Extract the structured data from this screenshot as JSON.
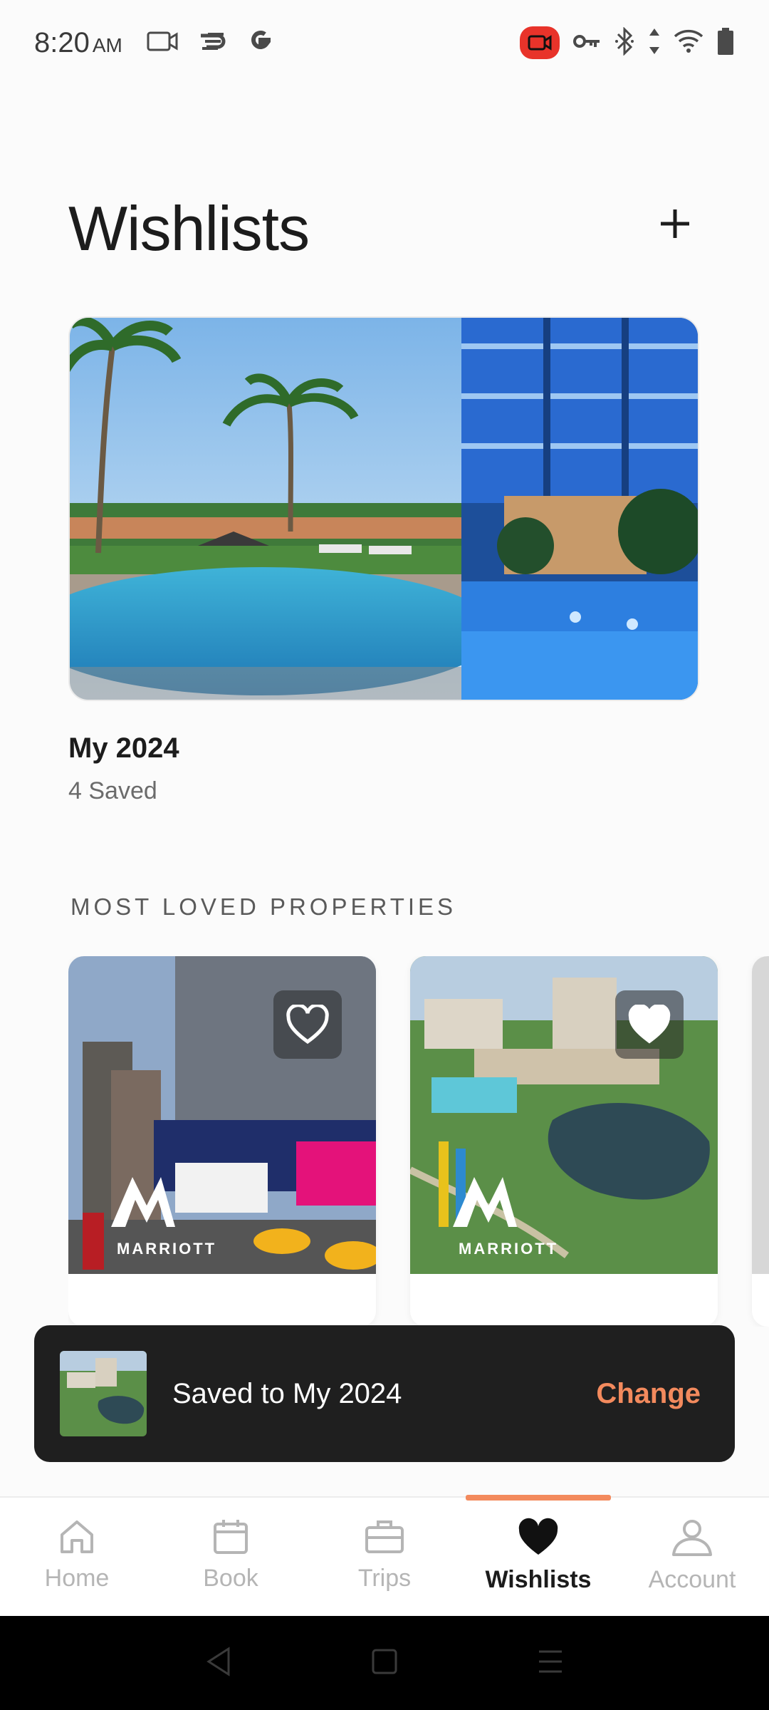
{
  "status_bar": {
    "time": "8:20",
    "ampm": "AM",
    "left_icons": [
      "screen-cast-icon",
      "link-app-icon",
      "google-icon"
    ],
    "right_icons": [
      "screen-record-icon",
      "vpn-key-icon",
      "bluetooth-icon",
      "data-arrows-icon",
      "wifi-icon",
      "battery-icon"
    ]
  },
  "header": {
    "title": "Wishlists",
    "add_icon": "plus-icon"
  },
  "wishlist": {
    "name": "My 2024",
    "count": "4 Saved"
  },
  "most_loved": {
    "heading": "MOST LOVED PROPERTIES",
    "properties": [
      {
        "brand": "MARRIOTT",
        "saved": false,
        "heart_icon": "heart-outline-icon"
      },
      {
        "brand": "MARRIOTT",
        "saved": true,
        "heart_icon": "heart-icon"
      }
    ]
  },
  "snackbar": {
    "message": "Saved to My 2024",
    "action": "Change"
  },
  "bottom_nav": {
    "items": [
      {
        "label": "Home",
        "icon": "home-icon"
      },
      {
        "label": "Book",
        "icon": "calendar-icon"
      },
      {
        "label": "Trips",
        "icon": "suitcase-icon"
      },
      {
        "label": "Wishlists",
        "icon": "heart-icon"
      },
      {
        "label": "Account",
        "icon": "person-icon"
      }
    ],
    "active": "Wishlists"
  },
  "colors": {
    "accent": "#f38a5d",
    "snackbar_bg": "#1f1f1f",
    "inactive_nav": "#b5b5b5",
    "record_red": "#e8332a"
  }
}
